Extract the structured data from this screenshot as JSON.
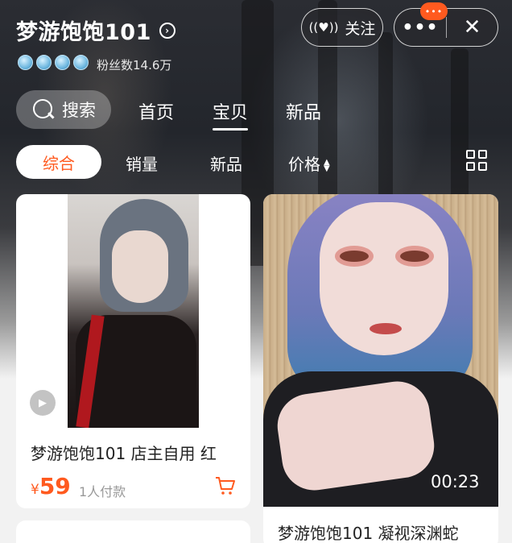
{
  "header": {
    "shop_name": "梦游饱饱101",
    "fans": "粉丝数14.6万",
    "follow_label": "关注",
    "more_label": "•••",
    "close_label": "✕",
    "badge_label": "•••"
  },
  "nav": {
    "search_label": "搜索",
    "tabs": [
      {
        "label": "首页"
      },
      {
        "label": "宝贝"
      },
      {
        "label": "新品"
      }
    ],
    "active_tab": "宝贝"
  },
  "filters": {
    "items": [
      {
        "label": "综合"
      },
      {
        "label": "销量"
      },
      {
        "label": "新品"
      },
      {
        "label": "价格"
      }
    ],
    "active": "综合"
  },
  "products": [
    {
      "title": "梦游饱饱101 店主自用 红",
      "currency": "¥",
      "price": "59",
      "sales": "1人付款"
    },
    {
      "title": "梦游饱饱101 凝视深渊蛇",
      "duration": "00:23"
    }
  ],
  "colors": {
    "accent": "#ff5a1f",
    "header_bg": "#23262c",
    "page_bg": "#f2f2f2"
  },
  "icons": [
    "chevron-right-icon",
    "crown-icon",
    "broadcast-icon",
    "more-icon",
    "close-icon",
    "search-icon",
    "sort-icon",
    "grid-view-icon",
    "play-icon",
    "cart-icon"
  ]
}
